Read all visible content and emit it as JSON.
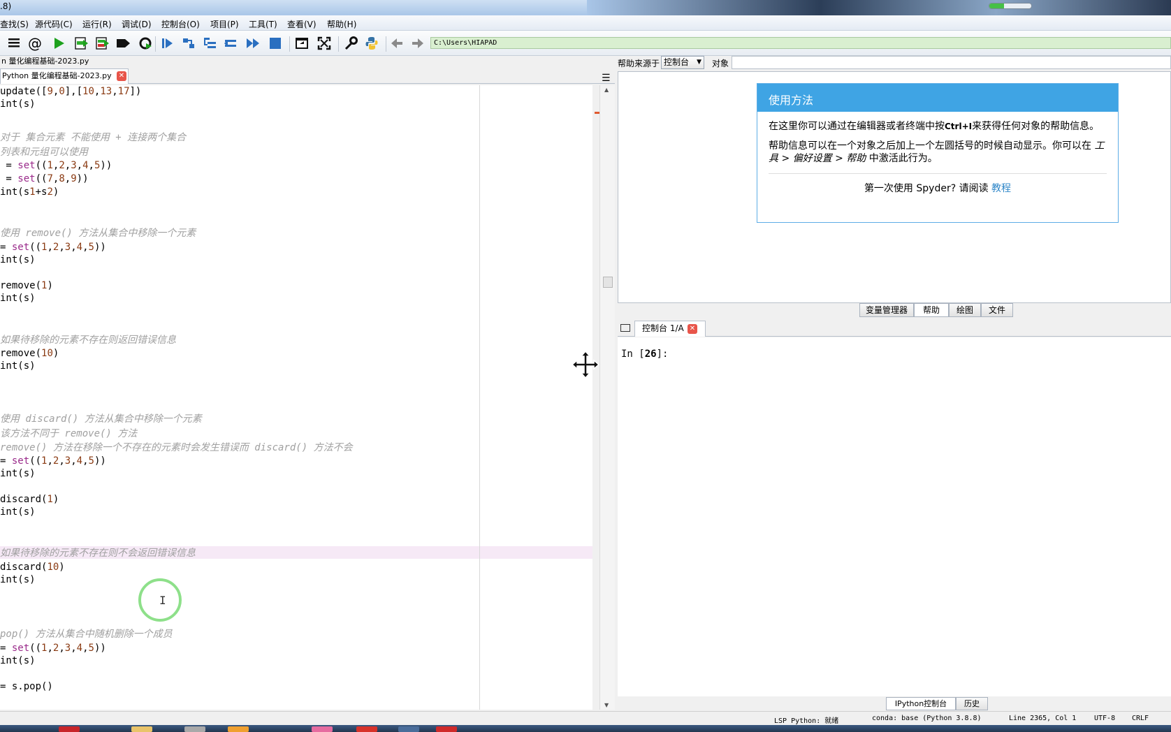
{
  "window": {
    "title_fragment": ".8)",
    "progress": 0.35
  },
  "menu": [
    "查找(S)",
    "源代码(C)",
    "运行(R)",
    "调试(D)",
    "控制台(O)",
    "项目(P)",
    "工具(T)",
    "查看(V)",
    "帮助(H)"
  ],
  "toolbar": {
    "icons": [
      "list-icon",
      "at-icon",
      "run-icon",
      "run-cell-icon",
      "run-cell-advance-icon",
      "run-selection-icon",
      "rerun-icon",
      "debug-icon",
      "step-icon",
      "step-into-icon",
      "step-return-icon",
      "continue-icon",
      "stop-icon",
      "maximize-pane-icon",
      "fullscreen-icon",
      "preferences-icon",
      "python-path-icon",
      "back-arrow-icon",
      "forward-arrow-icon"
    ],
    "working_dir": "C:\\Users\\HIAPAD"
  },
  "editor": {
    "filepath": "n 量化编程基础-2023.py",
    "tab_label": "Python 量化编程基础-2023.py",
    "lines": [
      {
        "type": "code",
        "text": "update([9,0],[10,13,17])"
      },
      {
        "type": "code",
        "text": "int(s)"
      },
      {
        "type": "blank",
        "text": ""
      },
      {
        "type": "blank",
        "text": ""
      },
      {
        "type": "comment",
        "text": "对于 集合元素 不能使用 + 连接两个集合"
      },
      {
        "type": "comment",
        "text": "列表和元组可以使用"
      },
      {
        "type": "code",
        "text": " = set((1,2,3,4,5))"
      },
      {
        "type": "code",
        "text": " = set((7,8,9))"
      },
      {
        "type": "code",
        "text": "int(s1+s2)"
      },
      {
        "type": "blank",
        "text": ""
      },
      {
        "type": "blank",
        "text": ""
      },
      {
        "type": "comment",
        "text": "使用 remove() 方法从集合中移除一个元素"
      },
      {
        "type": "code",
        "text": "= set((1,2,3,4,5))"
      },
      {
        "type": "code",
        "text": "int(s)"
      },
      {
        "type": "blank",
        "text": ""
      },
      {
        "type": "code",
        "text": "remove(1)"
      },
      {
        "type": "code",
        "text": "int(s)"
      },
      {
        "type": "blank",
        "text": ""
      },
      {
        "type": "blank",
        "text": ""
      },
      {
        "type": "comment",
        "text": "如果待移除的元素不存在则返回错误信息"
      },
      {
        "type": "code",
        "text": "remove(10)"
      },
      {
        "type": "code",
        "text": "int(s)"
      },
      {
        "type": "blank",
        "text": ""
      },
      {
        "type": "blank",
        "text": ""
      },
      {
        "type": "blank",
        "text": ""
      },
      {
        "type": "comment",
        "text": "使用 discard() 方法从集合中移除一个元素"
      },
      {
        "type": "comment",
        "text": "该方法不同于 remove() 方法"
      },
      {
        "type": "comment",
        "text": "remove() 方法在移除一个不存在的元素时会发生错误而 discard() 方法不会"
      },
      {
        "type": "code",
        "text": "= set((1,2,3,4,5))"
      },
      {
        "type": "code",
        "text": "int(s)"
      },
      {
        "type": "blank",
        "text": ""
      },
      {
        "type": "code",
        "text": "discard(1)"
      },
      {
        "type": "code",
        "text": "int(s)"
      },
      {
        "type": "blank",
        "text": ""
      },
      {
        "type": "blank",
        "text": ""
      },
      {
        "type": "comment",
        "text": "如果待移除的元素不存在则不会返回错误信息"
      },
      {
        "type": "code",
        "text": "discard(10)"
      },
      {
        "type": "code",
        "text": "int(s)"
      },
      {
        "type": "blank",
        "text": ""
      },
      {
        "type": "blank",
        "text": ""
      },
      {
        "type": "blank",
        "text": ""
      },
      {
        "type": "comment",
        "text": "pop() 方法从集合中随机删除一个成员"
      },
      {
        "type": "code",
        "text": "= set((1,2,3,4,5))"
      },
      {
        "type": "code",
        "text": "int(s)"
      },
      {
        "type": "blank",
        "text": ""
      },
      {
        "type": "code",
        "text": "= s.pop()"
      }
    ]
  },
  "help": {
    "source_label": "帮助来源于",
    "source_value": "控制台",
    "object_label": "对象",
    "card_title": "使用方法",
    "p1_a": "在这里你可以通过在编辑器或者终端中按",
    "p1_key": "Ctrl+I",
    "p1_b": "来获得任何对象的帮助信息。",
    "p2_a": "帮助信息可以在一个对象之后加上一个左圆括号的时候自动显示。你可以在",
    "p2_path": "工具 > 偏好设置 > 帮助",
    "p2_b": "中激活此行为。",
    "foot_text": "第一次使用 Spyder? 请阅读",
    "foot_link": "教程"
  },
  "pane_tabs": [
    "变量管理器",
    "帮助",
    "绘图",
    "文件"
  ],
  "console": {
    "tab_label": "控制台 1/A",
    "prompt_prefix": "In [",
    "prompt_num": "26",
    "prompt_suffix": "]:"
  },
  "bottom_tabs": [
    "IPython控制台",
    "历史"
  ],
  "status": {
    "lsp": "LSP Python: 就绪",
    "conda": "conda: base (Python 3.8.8)",
    "position": "Line 2365, Col 1",
    "encoding": "UTF-8",
    "eol": "CRLF"
  },
  "colors": {
    "accent": "#3fa4e4",
    "link": "#2e86c8",
    "comment": "#a0a0a0",
    "keyword": "#9a2a8a",
    "number": "#8a3a12"
  }
}
